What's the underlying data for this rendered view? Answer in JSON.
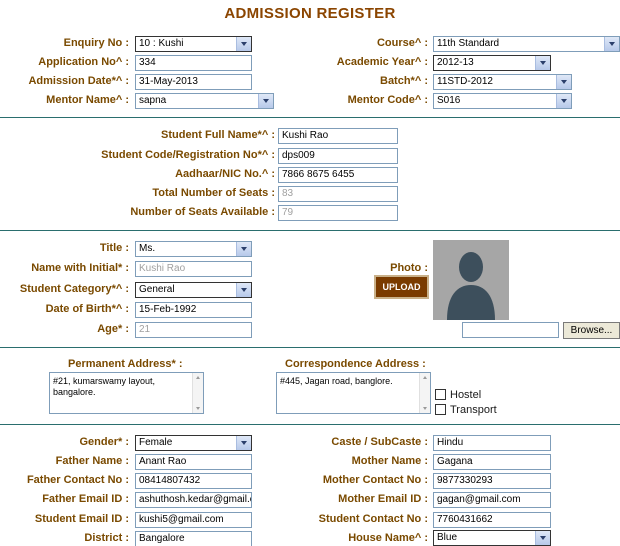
{
  "title": "ADMISSION REGISTER",
  "section1": {
    "enquiry_no": {
      "label": "Enquiry No :",
      "value": "10 : Kushi"
    },
    "course": {
      "label": "Course^ :",
      "value": "11th Standard"
    },
    "application_no": {
      "label": "Application No^ :",
      "value": "334"
    },
    "academic_year": {
      "label": "Academic Year^ :",
      "value": "2012-13"
    },
    "admission_date": {
      "label": "Admission Date*^ :",
      "value": "31-May-2013"
    },
    "batch": {
      "label": "Batch*^ :",
      "value": "11STD-2012"
    },
    "mentor_name": {
      "label": "Mentor Name^ :",
      "value": "sapna"
    },
    "mentor_code": {
      "label": "Mentor Code^ :",
      "value": "S016"
    }
  },
  "section2": {
    "full_name": {
      "label": "Student Full Name*^ :",
      "value": "Kushi Rao"
    },
    "student_code": {
      "label": "Student Code/Registration No*^ :",
      "value": "dps009"
    },
    "aadhaar": {
      "label": "Aadhaar/NIC No.^ :",
      "value": "7866 8675 6455"
    },
    "total_seats": {
      "label": "Total Number of Seats :",
      "value": "83"
    },
    "seats_available": {
      "label": "Number of Seats Available :",
      "value": "79"
    }
  },
  "section3": {
    "title_field": {
      "label": "Title :",
      "value": "Ms."
    },
    "name_initial": {
      "label": "Name with Initial* :",
      "value": "Kushi Rao"
    },
    "category": {
      "label": "Student Category*^ :",
      "value": "General"
    },
    "dob": {
      "label": "Date of Birth*^ :",
      "value": "15-Feb-1992"
    },
    "age": {
      "label": "Age* :",
      "value": "21"
    },
    "photo_label": "Photo :",
    "upload_label": "UPLOAD",
    "browse_label": "Browse...",
    "file_value": ""
  },
  "section4": {
    "permanent_label": "Permanent Address* :",
    "permanent_line1": "#21, kumarswamy layout,",
    "permanent_line2": "bangalore.",
    "correspondence_label": "Correspondence Address :",
    "correspondence_value": "#445, Jagan road, banglore.",
    "hostel_label": "Hostel",
    "transport_label": "Transport"
  },
  "section5": {
    "gender": {
      "label": "Gender* :",
      "value": "Female"
    },
    "caste": {
      "label": "Caste / SubCaste :",
      "value": "Hindu"
    },
    "father_name": {
      "label": "Father Name :",
      "value": "Anant Rao"
    },
    "mother_name": {
      "label": "Mother Name :",
      "value": "Gagana"
    },
    "father_contact": {
      "label": "Father Contact No :",
      "value": "08414807432"
    },
    "mother_contact": {
      "label": "Mother Contact No :",
      "value": "9877330293"
    },
    "father_email": {
      "label": "Father Email ID :",
      "value": "ashuthosh.kedar@gmail.co"
    },
    "mother_email": {
      "label": "Mother Email ID :",
      "value": "gagan@gmail.com"
    },
    "student_email": {
      "label": "Student Email ID :",
      "value": "kushi5@gmail.com"
    },
    "student_contact": {
      "label": "Student Contact No :",
      "value": "7760431662"
    },
    "district": {
      "label": "District :",
      "value": "Bangalore"
    },
    "house_name": {
      "label": "House Name^ :",
      "value": "Blue"
    }
  }
}
